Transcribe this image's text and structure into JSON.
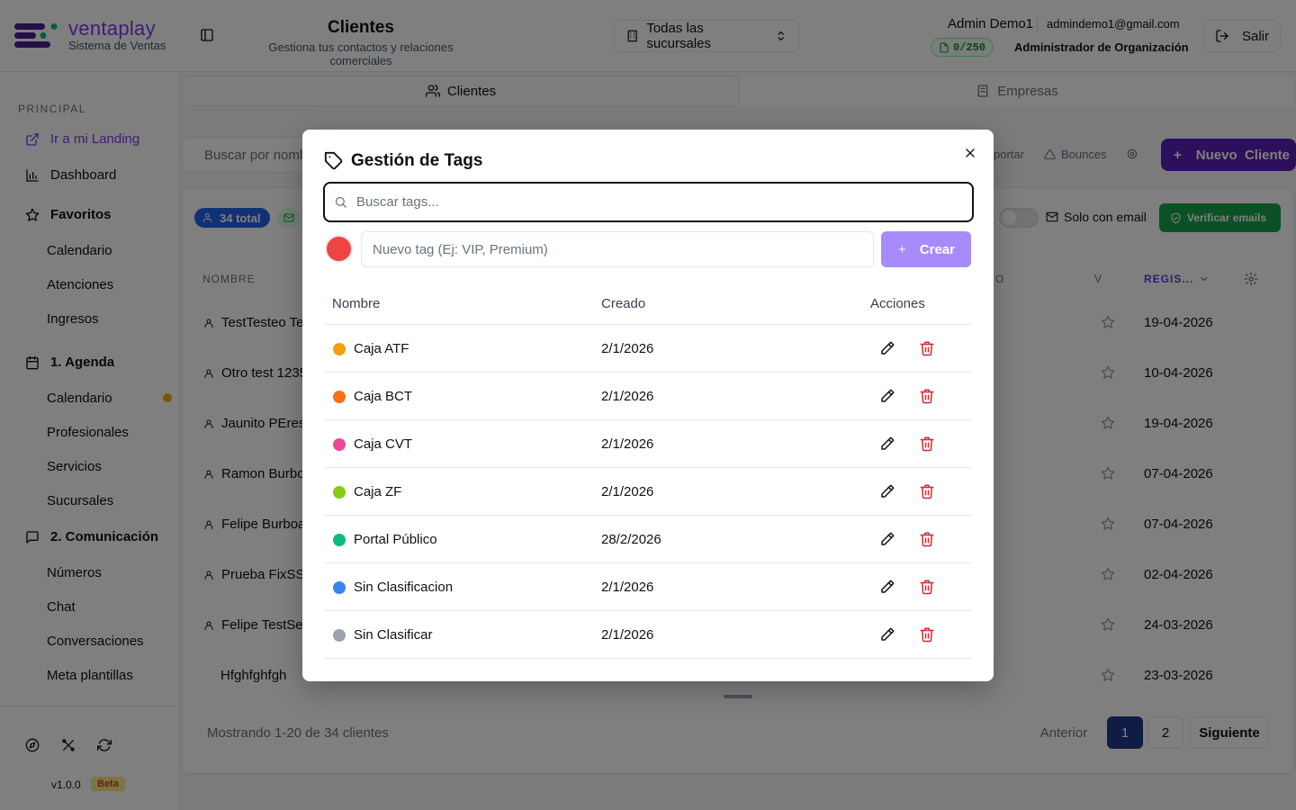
{
  "brand": {
    "name": "ventaplay",
    "subtitle": "Sistema de Ventas"
  },
  "header": {
    "title": "Clientes",
    "subtitle": "Gestiona tus contactos y relaciones comerciales",
    "branch_select": "Todas las sucursales",
    "user_name": "Admin Demo1",
    "user_email": "admindemo1@gmail.com",
    "quota": "0/250",
    "role": "Administrador de Organización",
    "logout": "Salir"
  },
  "sidebar": {
    "section": "PRINCIPAL",
    "landing": "Ir a mi Landing",
    "dashboard": "Dashboard",
    "favoritos": "Favoritos",
    "fav_items": [
      "Calendario",
      "Atenciones",
      "Ingresos"
    ],
    "agenda": "1. Agenda",
    "agenda_items": [
      "Calendario",
      "Profesionales",
      "Servicios",
      "Sucursales"
    ],
    "comunicacion": "2. Comunicación",
    "com_items": [
      "Números",
      "Chat",
      "Conversaciones",
      "Meta plantillas"
    ],
    "version": "v1.0.0",
    "beta": "Beta"
  },
  "main": {
    "tabs": [
      "Clientes",
      "Empresas"
    ],
    "search_placeholder": "Buscar por nombre",
    "tools": [
      "portar",
      "Bounces"
    ],
    "new_client": "Nuevo  Cliente",
    "total_badge": "34 total",
    "only_email": "Solo con email",
    "verify": "Verificar emails",
    "columns": [
      "NOMBRE",
      "O",
      "V",
      "REGIS..."
    ],
    "rows": [
      {
        "name": "TestTesteo Te",
        "date": "19-04-2026"
      },
      {
        "name": "Otro test 1235",
        "date": "10-04-2026"
      },
      {
        "name": "Jaunito PEres",
        "date": "19-04-2026"
      },
      {
        "name": "Ramon Burboa",
        "date": "07-04-2026"
      },
      {
        "name": "Felipe Burboa",
        "date": "07-04-2026"
      },
      {
        "name": "Prueba FixSS",
        "date": "02-04-2026"
      },
      {
        "name": "Felipe TestSe",
        "date": "24-03-2026"
      },
      {
        "name": "Hfghfghfgh",
        "date": "23-03-2026"
      }
    ],
    "pagination_info": "Mostrando 1-20 de 34 clientes",
    "pagination": {
      "prev": "Anterior",
      "page1": "1",
      "page2": "2",
      "next": "Siguiente"
    }
  },
  "modal": {
    "title": "Gestión de Tags",
    "search_placeholder": "Buscar tags...",
    "new_tag_placeholder": "Nuevo tag (Ej: VIP, Premium)",
    "selected_color": "#ef4444",
    "create_label": "Crear",
    "columns": {
      "name": "Nombre",
      "created": "Creado",
      "actions": "Acciones"
    },
    "tags": [
      {
        "name": "Caja ATF",
        "created": "2/1/2026",
        "color": "#f59e0b"
      },
      {
        "name": "Caja BCT",
        "created": "2/1/2026",
        "color": "#f97316"
      },
      {
        "name": "Caja CVT",
        "created": "2/1/2026",
        "color": "#ec4899"
      },
      {
        "name": "Caja ZF",
        "created": "2/1/2026",
        "color": "#84cc16"
      },
      {
        "name": "Portal Público",
        "created": "28/2/2026",
        "color": "#10b981"
      },
      {
        "name": "Sin Clasificacion",
        "created": "2/1/2026",
        "color": "#3b82f6"
      },
      {
        "name": "Sin Clasificar",
        "created": "2/1/2026",
        "color": "#9ca3af"
      }
    ]
  }
}
